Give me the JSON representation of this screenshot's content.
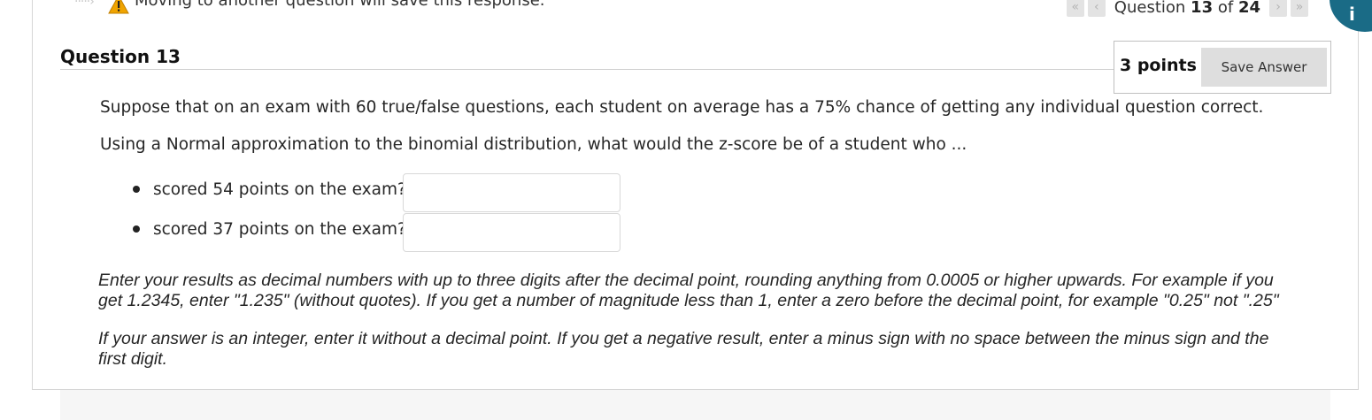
{
  "topbar": {
    "warning_text": "Moving to another question will save this response.",
    "nav": {
      "first_glyph": "«",
      "prev_glyph": "‹",
      "next_glyph": "›",
      "last_glyph": "»",
      "question_prefix": "Question",
      "current": "13",
      "of_label": "of",
      "total": "24"
    }
  },
  "question": {
    "title": "Question 13",
    "points": "3 points",
    "save_label": "Save Answer",
    "prompt_1": "Suppose that on an exam with 60 true/false questions, each student on average has a 75% chance of getting any individual question correct.",
    "prompt_2": "Using a Normal approximation to the binomial distribution, what would the z-score be of a student who ...",
    "items": [
      {
        "label": "scored 54 points on the exam?",
        "value": ""
      },
      {
        "label": "scored 37 points on the exam?",
        "value": ""
      }
    ],
    "instructions_1": "Enter your results as decimal numbers with up to three digits after the decimal point, rounding anything from 0.0005 or higher upwards. For example if you get 1.2345, enter \"1.235\" (without quotes). If you get a number of magnitude less than 1, enter a zero before the decimal point, for example \"0.25\" not \".25\"",
    "instructions_2": "If your answer is an integer, enter it without a decimal point. If you get a negative result, enter a minus sign with no space between the minus sign and the first digit."
  },
  "colors": {
    "accent": "#1a6b86",
    "warning": "#f0a400",
    "button_bg": "#dedede"
  },
  "icons": {
    "warning": "warning-triangle-icon",
    "help": "info-icon"
  }
}
